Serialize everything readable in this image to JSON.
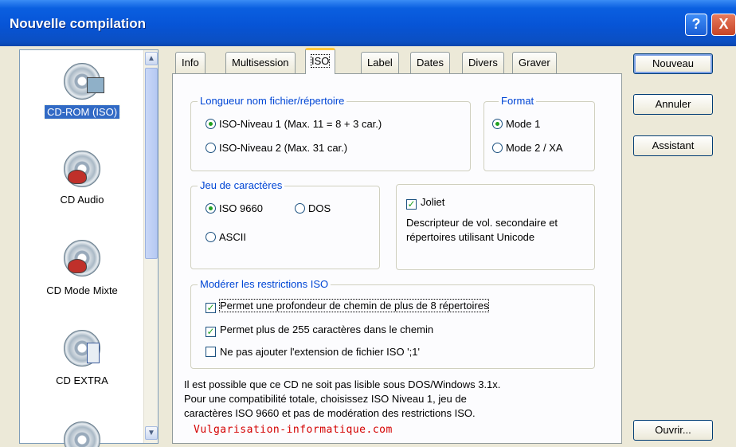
{
  "window": {
    "title": "Nouvelle compilation",
    "help_label": "?",
    "close_label": "X"
  },
  "icon_list": {
    "items": [
      {
        "label": "CD-ROM (ISO)",
        "selected": true,
        "icon": "cd-rom-disc-icon"
      },
      {
        "label": "CD Audio",
        "selected": false,
        "icon": "cd-audio-disc-icon"
      },
      {
        "label": "CD Mode Mixte",
        "selected": false,
        "icon": "cd-mixed-mode-disc-icon"
      },
      {
        "label": "CD EXTRA",
        "selected": false,
        "icon": "cd-extra-disc-icon"
      },
      {
        "label": "",
        "selected": false,
        "icon": "disc-icon"
      }
    ],
    "scroll_up": "▲",
    "scroll_down": "▼"
  },
  "tabs": [
    {
      "label": "Info",
      "active": false
    },
    {
      "label": "Multisession",
      "active": false
    },
    {
      "label": "ISO",
      "active": true
    },
    {
      "label": "Label",
      "active": false
    },
    {
      "label": "Dates",
      "active": false
    },
    {
      "label": "Divers",
      "active": false
    },
    {
      "label": "Graver",
      "active": false
    }
  ],
  "iso": {
    "filename_length": {
      "title": "Longueur nom fichier/répertoire",
      "options": [
        {
          "label": "ISO-Niveau 1 (Max. 11 = 8 + 3 car.)",
          "checked": true
        },
        {
          "label": "ISO-Niveau 2 (Max. 31 car.)",
          "checked": false
        }
      ]
    },
    "format": {
      "title": "Format",
      "options": [
        {
          "label": "Mode 1",
          "checked": true
        },
        {
          "label": "Mode 2 / XA",
          "checked": false
        }
      ]
    },
    "charset": {
      "title": "Jeu de caractères",
      "options": [
        {
          "label": "ISO 9660",
          "checked": true
        },
        {
          "label": "DOS",
          "checked": false
        },
        {
          "label": "ASCII",
          "checked": false
        }
      ]
    },
    "joliet": {
      "label": "Joliet",
      "checked": true,
      "description_line1": "Descripteur de vol. secondaire et",
      "description_line2": "répertoires utilisant Unicode"
    },
    "relax": {
      "title": "Modérer les restrictions ISO",
      "options": [
        {
          "label": "Permet une profondeur de chemin de plus de 8 répertoires",
          "checked": true
        },
        {
          "label": "Permet plus de 255 caractères dans le chemin",
          "checked": true
        },
        {
          "label": "Ne pas ajouter l'extension de fichier ISO ';1'",
          "checked": false
        }
      ]
    },
    "warning_lines": [
      "Il est possible que ce CD ne soit pas lisible sous DOS/Windows 3.1x.",
      "Pour une compatibilité totale, choisissez ISO Niveau 1, jeu de",
      "caractères ISO 9660 et pas de modération des restrictions ISO."
    ]
  },
  "buttons": {
    "new": "Nouveau",
    "cancel": "Annuler",
    "wizard": "Assistant",
    "open": "Ouvrir..."
  },
  "watermark": "Vulgarisation-informatique.com",
  "colors": {
    "title_bar": "#0754d6",
    "group_title": "#0046d5",
    "selection": "#316ac5",
    "watermark": "#d40000"
  }
}
